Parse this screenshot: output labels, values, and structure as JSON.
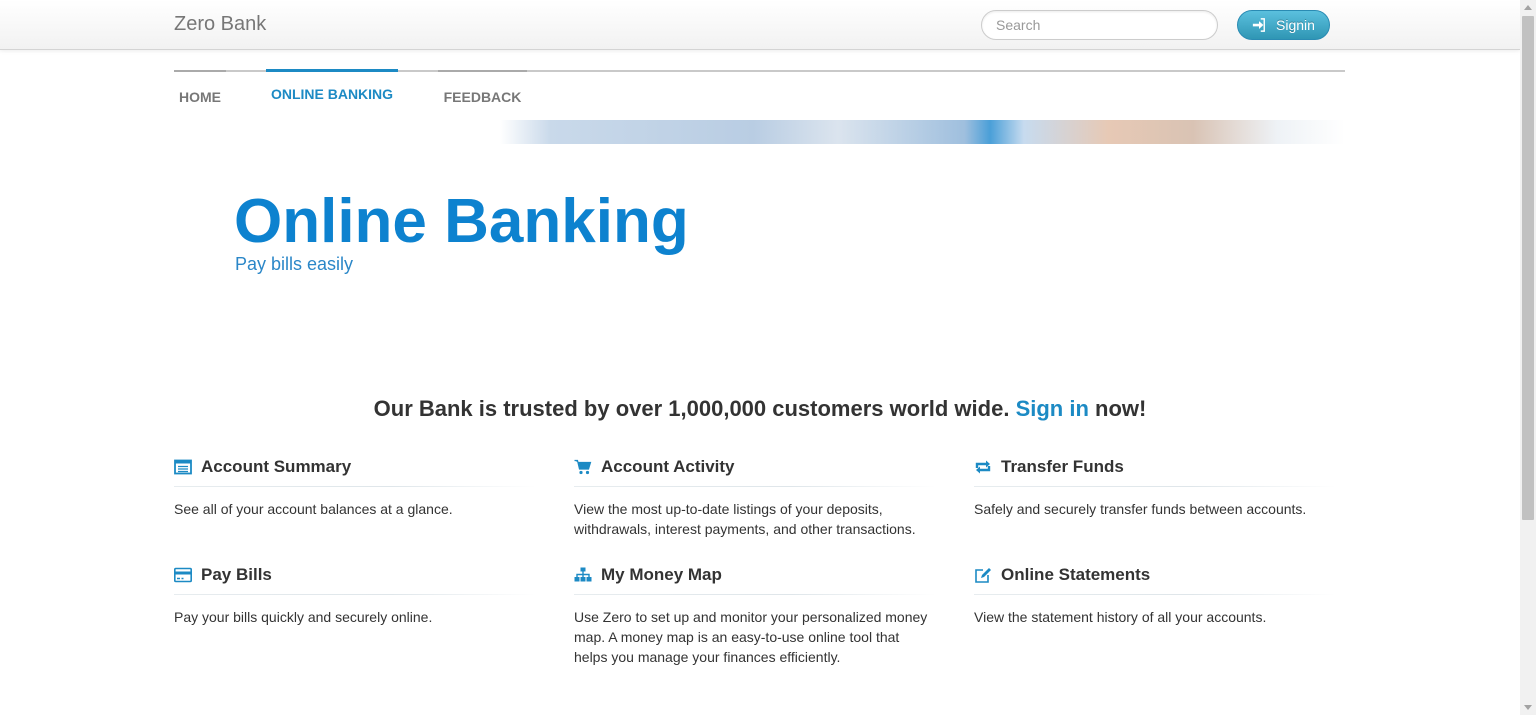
{
  "navbar": {
    "brand": "Zero Bank",
    "search_placeholder": "Search",
    "signin_label": "Signin"
  },
  "tabs": [
    {
      "label": "HOME",
      "active": false
    },
    {
      "label": "ONLINE BANKING",
      "active": true
    },
    {
      "label": "FEEDBACK",
      "active": false
    }
  ],
  "hero": {
    "title": "Online Banking",
    "subtitle": "Pay bills easily"
  },
  "trust": {
    "before": "Our Bank is trusted by over 1,000,000 customers world wide.",
    "link": "Sign in",
    "after": "now!"
  },
  "features": [
    {
      "icon": "list-icon",
      "title": "Account Summary",
      "text": "See all of your account balances at a glance."
    },
    {
      "icon": "cart-icon",
      "title": "Account Activity",
      "text": "View the most up-to-date listings of your deposits, withdrawals, interest payments, and other transactions."
    },
    {
      "icon": "transfer-icon",
      "title": "Transfer Funds",
      "text": "Safely and securely transfer funds between accounts."
    },
    {
      "icon": "credit-card-icon",
      "title": "Pay Bills",
      "text": "Pay your bills quickly and securely online."
    },
    {
      "icon": "sitemap-icon",
      "title": "My Money Map",
      "text": "Use Zero to set up and monitor your personalized money map. A money map is an easy-to-use online tool that helps you manage your finances efficiently."
    },
    {
      "icon": "edit-icon",
      "title": "Online Statements",
      "text": "View the statement history of all your accounts."
    }
  ],
  "colors": {
    "accent": "#1c8ac4",
    "hero_title": "#0d82cf",
    "button": "#2f96b4"
  }
}
